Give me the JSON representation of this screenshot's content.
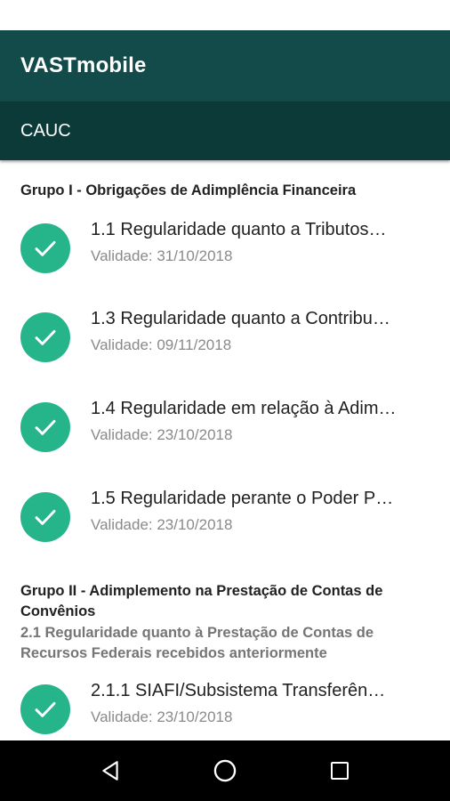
{
  "app": {
    "title": "VASTmobile",
    "subtitle": "CAUC"
  },
  "colors": {
    "appbar": "#124b4a",
    "subbar": "#0c3a39",
    "check": "#26b58b"
  },
  "groups": [
    {
      "title": "Grupo I - Obrigações de Adimplência Financeira",
      "items": [
        {
          "title": "1.1 Regularidade quanto a Tributos…",
          "validity": "Validade: 31/10/2018",
          "icon": "check-circle-icon"
        },
        {
          "title": "1.3 Regularidade quanto a Contribu…",
          "validity": "Validade: 09/11/2018",
          "icon": "check-circle-icon"
        },
        {
          "title": "1.4 Regularidade em relação à Adim…",
          "validity": "Validade: 23/10/2018",
          "icon": "check-circle-icon"
        },
        {
          "title": "1.5 Regularidade perante o Poder P…",
          "validity": "Validade: 23/10/2018",
          "icon": "check-circle-icon"
        }
      ]
    },
    {
      "title_line1": "Grupo II - Adimplemento na Prestação de Contas de",
      "title_line2": "Convênios",
      "subtitle_line1": "2.1 Regularidade quanto à Prestação de Contas de",
      "subtitle_line2": "Recursos Federais recebidos anteriormente",
      "items": [
        {
          "title": "2.1.1 SIAFI/Subsistema Transferên…",
          "validity": "Validade: 23/10/2018",
          "icon": "check-circle-icon"
        }
      ]
    }
  ],
  "navbar": {
    "back": "back-icon",
    "home": "home-icon",
    "recents": "recents-icon"
  }
}
